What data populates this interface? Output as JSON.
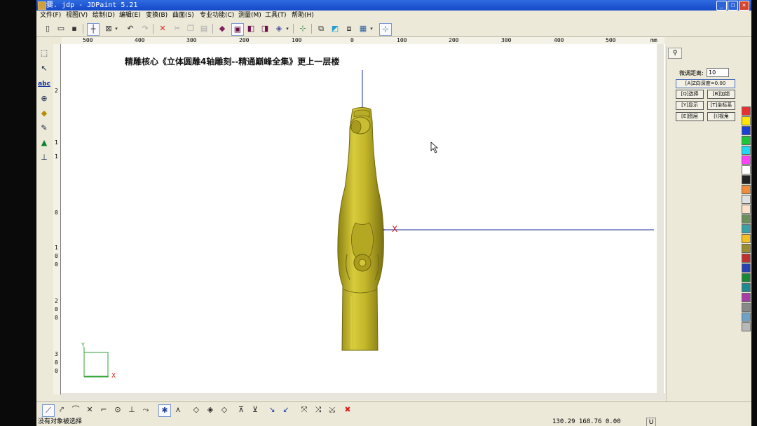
{
  "window": {
    "title": "爨. jdp - JDPaint 5.21",
    "buttons": {
      "minimize": "_",
      "restore": "❐",
      "close": "✕"
    }
  },
  "menu": [
    "文件(F)",
    "视图(V)",
    "绘制(D)",
    "编辑(E)",
    "变换(B)",
    "曲面(S)",
    "专业功能(C)",
    "测量(M)",
    "工具(T)",
    "帮助(H)"
  ],
  "ruler": {
    "h_labels": [
      "500",
      "400",
      "300",
      "200",
      "100",
      "0",
      "100",
      "200",
      "300",
      "400",
      "500"
    ],
    "unit": "mm",
    "v_digits": [
      "2",
      "1",
      "1",
      "0",
      "1",
      "0",
      "0",
      "2",
      "0",
      "0",
      "3",
      "0",
      "0"
    ]
  },
  "canvas": {
    "banner": "精雕核心《立体圆雕4轴雕刻--精通巅峰全集》更上一层楼",
    "x_axis_label": "X",
    "ucs": {
      "x": "X",
      "y": "Y"
    }
  },
  "panel": {
    "tab_icon": "glyph-icon",
    "fine_tune_label": "微调距离:",
    "fine_tune_value": "10",
    "z_depth_button": "[A]Z向深度=0.00",
    "buttons": [
      "[Q]选择",
      "[B]加锁",
      "[Y]显示",
      "[T]坐标系",
      "[E]图层",
      "[I]视角"
    ]
  },
  "palette": {
    "colors": [
      "#e83030",
      "#ffe600",
      "#1c3fd6",
      "#18c838",
      "#20d8f0",
      "#ff40ff",
      "#ffffff",
      "#222222",
      "#f08c3c",
      "#e0e0e0",
      "#fde0c8",
      "#6a8f5a",
      "#3aa0a8",
      "#f2c020",
      "#9a8c30",
      "#c03030",
      "#2840b0",
      "#188838",
      "#208890",
      "#a83ca8",
      "#888888",
      "#6ea0c8",
      "#b8b8b8"
    ]
  },
  "status": {
    "message": "没有对象被选择",
    "coords": "130.29 168.76 0.00",
    "mode": "U"
  },
  "theme": {
    "model_fill": "#c2b62a",
    "model_dark": "#8c8212",
    "axis_color": "#1c2c9c",
    "accent_red": "#d42020"
  }
}
